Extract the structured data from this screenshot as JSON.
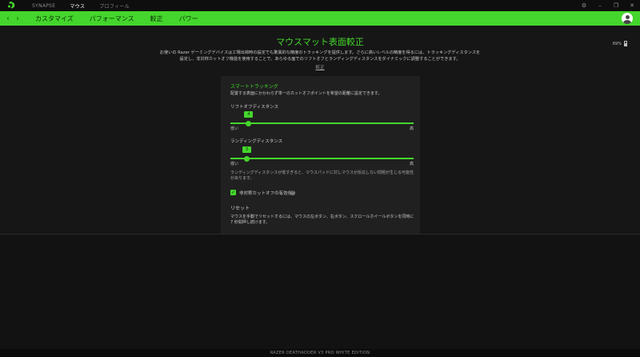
{
  "titlebar": {
    "tabs": [
      "SYNAPSE",
      "マウス",
      "プロフィール"
    ],
    "active_tab": 1
  },
  "navbar": {
    "tabs": [
      "カスタマイズ",
      "パフォーマンス",
      "較正",
      "パワー"
    ]
  },
  "page": {
    "title": "マウスマット表面較正",
    "battery": "69%",
    "description_line1": "お使いの Razer ゲーミングデバイスは工場出荷時の設定でも驚異的な精度のトラッキングを提供します。さらに高いレベルの精度を得るには、トラッキングディスタンスを",
    "description_line2": "設定し、非対称カットオフ機能を使用することで、あらゆる面でのリフトオフとランディングディスタンスをダイナミックに調整することができます。",
    "calibration_link": "較正"
  },
  "panel": {
    "header": "スマートトラッキング",
    "subheader": "配置する表面にかかわらず単一のカットオフポイントを希望の距離に設定できます。",
    "liftoff": {
      "label": "リフトオフディスタンス",
      "value": "4",
      "fraction": 0.1,
      "min_label": "低い",
      "max_label": "高"
    },
    "landing": {
      "label": "ランディングディスタンス",
      "value": "3",
      "fraction": 0.09,
      "min_label": "低い",
      "max_label": "高"
    },
    "note": "ランディングディスタンスが低すぎると、マウスパッドに対しマウスが反応しない問題が生じる可能性があります。",
    "asym_cutoff_label": "非対称カットオフの有効化",
    "asym_cutoff_checked": true,
    "reset_title": "リセット",
    "reset_text": "マウスを手動でリセットするには、マウスの左ボタン、右ボタン、スクロールホイールボタンを同時に 7 秒間押し続けます。"
  },
  "footer": {
    "device_name": "RAZER DEATHADDER V3 PRO WHITE EDITION"
  },
  "colors": {
    "accent": "#44d62c",
    "background": "#161616",
    "panel": "#202020"
  },
  "icons": {
    "logo": "razer-logo-icon",
    "settings": "gear-icon",
    "minimize": "minimize-icon",
    "maximize": "maximize-icon",
    "close": "close-icon",
    "back": "chevron-left-icon",
    "forward": "chevron-right-icon",
    "battery": "battery-icon",
    "help": "help-icon",
    "check": "check-icon",
    "avatar": "user-avatar-icon"
  }
}
